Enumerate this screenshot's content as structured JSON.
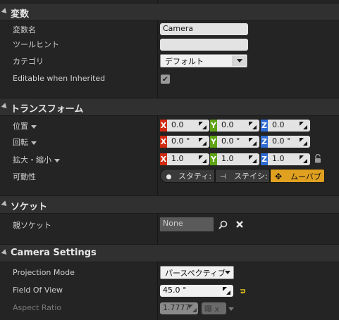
{
  "sections": {
    "variables": {
      "title": "変数"
    },
    "transform": {
      "title": "トランスフォーム"
    },
    "socket": {
      "title": "ソケット"
    },
    "camera": {
      "title": "Camera Settings"
    }
  },
  "variables": {
    "name_label": "変数名",
    "name_value": "Camera",
    "tooltip_label": "ツールヒント",
    "tooltip_value": "",
    "category_label": "カテゴリ",
    "category_value": "デフォルト",
    "editable_label": "Editable when Inherited",
    "editable_checked": "✔"
  },
  "transform": {
    "location": {
      "label": "位置",
      "x": "0.0",
      "y": "0.0",
      "z": "0.0"
    },
    "rotation": {
      "label": "回転",
      "x": "0.0 °",
      "y": "0.0 °",
      "z": "0.0 °"
    },
    "scale": {
      "label": "拡大・縮小",
      "x": "1.0",
      "y": "1.0",
      "z": "1.0"
    },
    "axis_labels": {
      "x": "X",
      "y": "Y",
      "z": "Z"
    },
    "mobility": {
      "label": "可動性",
      "options": [
        "スタティ:",
        "ステイシ:",
        "ムーバブ"
      ],
      "selected": "ムーバブ"
    }
  },
  "socket": {
    "parent_label": "親ソケット",
    "parent_value": "None"
  },
  "camera": {
    "projection_label": "Projection Mode",
    "projection_value": "パースペクティブ",
    "fov_label": "Field Of View",
    "fov_value": "45.0 °",
    "aspect_label": "Aspect Ratio",
    "aspect_value": "1.7777",
    "aspect_extra": "曝 x "
  },
  "colors": {
    "axis_x": "#d02b10",
    "axis_y": "#5fa414",
    "axis_z": "#2e6bd3",
    "mobility_active": "#e0a020"
  }
}
